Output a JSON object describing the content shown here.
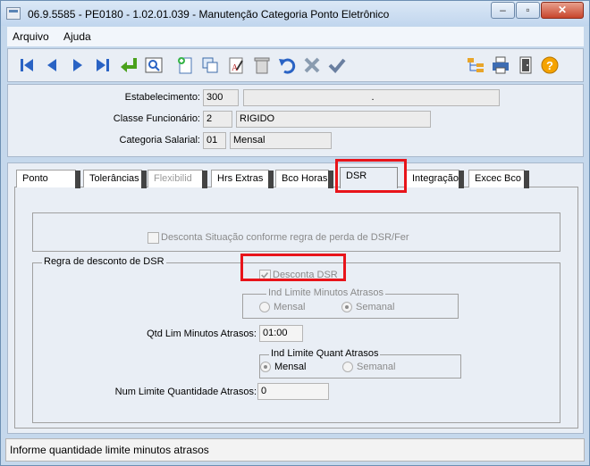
{
  "window": {
    "title": "06.9.5585 - PE0180 - 1.02.01.039 - Manutenção Categoria Ponto Eletrônico"
  },
  "menu": {
    "items": [
      "Arquivo",
      "Ajuda"
    ]
  },
  "toolbar": {
    "icons": [
      "first-icon",
      "prev-icon",
      "next-icon",
      "last-icon",
      "goto-icon",
      "search-icon",
      "new-icon",
      "copy-icon",
      "edit-icon",
      "delete-icon",
      "undo-icon",
      "cancel-icon",
      "ok-icon",
      "tree-icon",
      "print-icon",
      "exit-icon",
      "help-icon"
    ]
  },
  "header": {
    "estabelecimento": {
      "label": "Estabelecimento:",
      "code": "300",
      "desc": "."
    },
    "classe": {
      "label": "Classe Funcionário:",
      "code": "2",
      "desc": "RIGIDO"
    },
    "categoria": {
      "label": "Categoria Salarial:",
      "code": "01",
      "desc": "Mensal"
    }
  },
  "tabs": [
    {
      "label": "Ponto"
    },
    {
      "label": "Tolerâncias"
    },
    {
      "label": "Flexibilid"
    },
    {
      "label": "Hrs Extras"
    },
    {
      "label": "Bco Horas"
    },
    {
      "label": "DSR"
    },
    {
      "label": "Integração"
    },
    {
      "label": "Excec Bco"
    }
  ],
  "dsr": {
    "situacao_checkbox": "Desconta Situação conforme regra de perda de DSR/Fer",
    "regra_title": "Regra de desconto de DSR",
    "desconta_dsr": "Desconta DSR",
    "ind_limite_minutos": {
      "title": "Ind Limite Minutos Atrasos",
      "options": [
        "Mensal",
        "Semanal"
      ],
      "selected": "Semanal"
    },
    "qtd_lim_minutos": {
      "label": "Qtd Lim Minutos Atrasos:",
      "value": "01:00"
    },
    "ind_limite_quant": {
      "title": "Ind Limite Quant Atrasos",
      "options": [
        "Mensal",
        "Semanal"
      ],
      "selected": "Mensal"
    },
    "num_limite": {
      "label": "Num Limite Quantidade Atrasos:",
      "value": "0"
    }
  },
  "status": {
    "text": "Informe quantidade limite minutos atrasos"
  },
  "colors": {
    "highlight": "#e8141a",
    "window_bg": "#c5d8ec"
  }
}
